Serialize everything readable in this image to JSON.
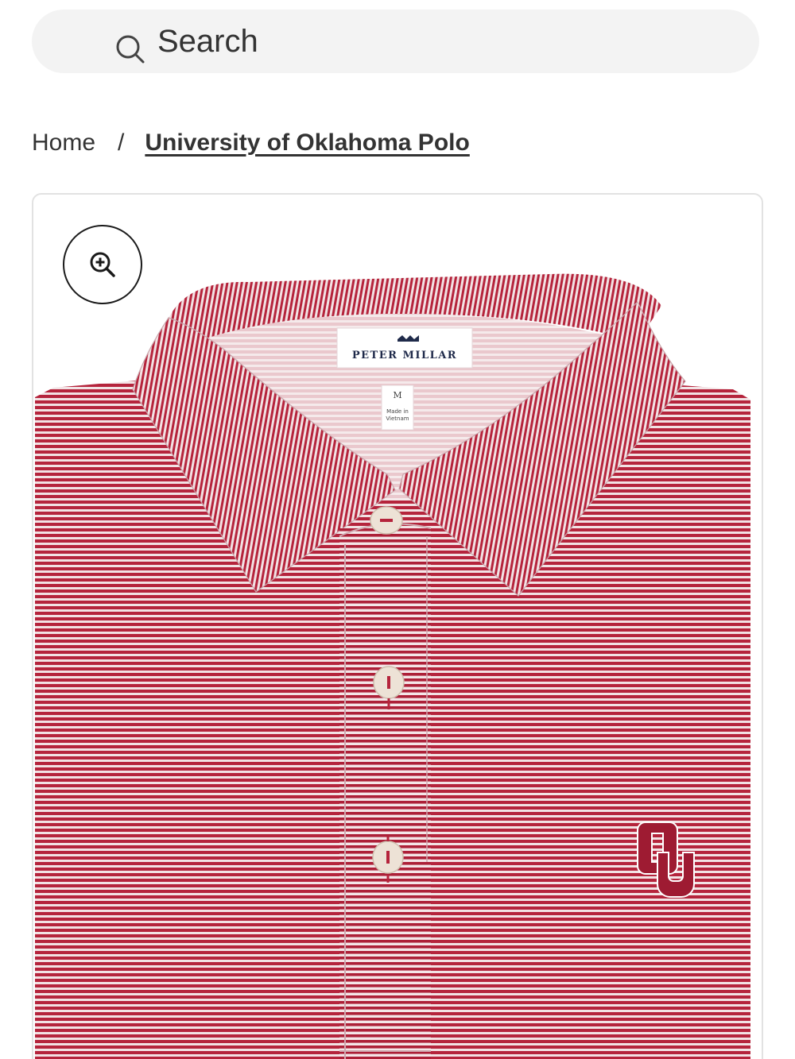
{
  "search": {
    "placeholder": "Search",
    "icon": "search-icon"
  },
  "breadcrumb": {
    "home": "Home",
    "separator": "/",
    "current": "University of Oklahoma Polo"
  },
  "product": {
    "zoom_icon": "zoom-in-icon",
    "label_brand": "PETER MILLAR",
    "size_tag": "M",
    "origin_tag_line1": "Made in",
    "origin_tag_line2": "Vietnam",
    "logo_text": "OU",
    "colors": {
      "shirt": "#b5243c",
      "stripe_light": "#f2e2e4",
      "button": "#ede2d6",
      "logo": "#9e1b32"
    }
  }
}
